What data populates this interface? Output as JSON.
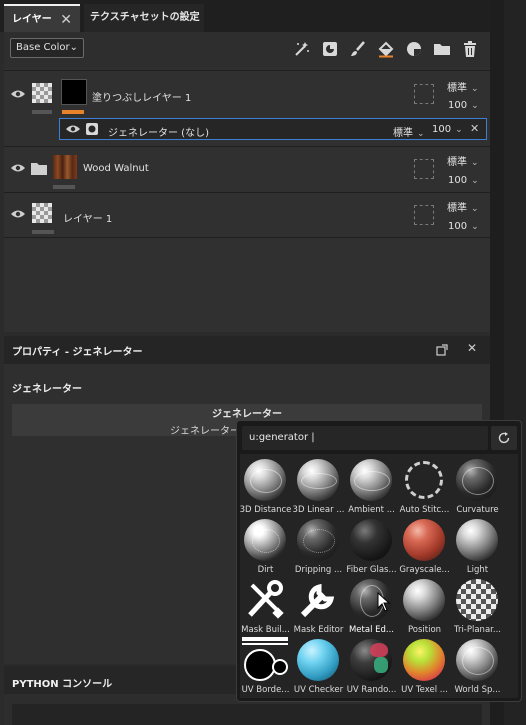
{
  "tabs": {
    "layers_label": "レイヤー",
    "layers_close": "✕",
    "texset_label": "テクスチャセットの設定"
  },
  "toolbar": {
    "channel": "Base Color",
    "icons": [
      "add-effect-icon",
      "add-mask-icon",
      "paint-brush-icon",
      "fill-bucket-icon",
      "smart-material-icon",
      "folder-icon",
      "trash-icon"
    ]
  },
  "layers": [
    {
      "name": "塗りつぶしレイヤー 1",
      "blend": "標準",
      "opacity": "100"
    },
    {
      "name": "ジェネレーター (なし)",
      "blend": "標準",
      "opacity": "100"
    },
    {
      "name": "Wood Walnut",
      "blend": "標準",
      "opacity": "100"
    },
    {
      "name": "レイヤー 1",
      "blend": "標準",
      "opacity": "100"
    }
  ],
  "properties": {
    "title": "プロパティ - ジェネレーター",
    "section": "ジェネレーター",
    "box_title": "ジェネレーター",
    "box_sub": "ジェネレーター/"
  },
  "python": {
    "title": "PYTHON コンソール"
  },
  "popup": {
    "search_value": "u:generator |",
    "items": [
      "3D Distance",
      "3D Linear ...",
      "Ambient ...",
      "Auto Stitc...",
      "Curvature",
      "Dirt",
      "Dripping ...",
      "Fiber Glas...",
      "Grayscale...",
      "Light",
      "Mask Buil...",
      "Mask Editor",
      "Metal Ed...",
      "Position",
      "Tri-Planar...",
      "UV Borde...",
      "UV Checker",
      "UV Rando...",
      "UV Texel ...",
      "World Sp..."
    ]
  },
  "colors": {
    "accent_orange": "#e8822a",
    "selection_border": "#3d7fd4"
  }
}
